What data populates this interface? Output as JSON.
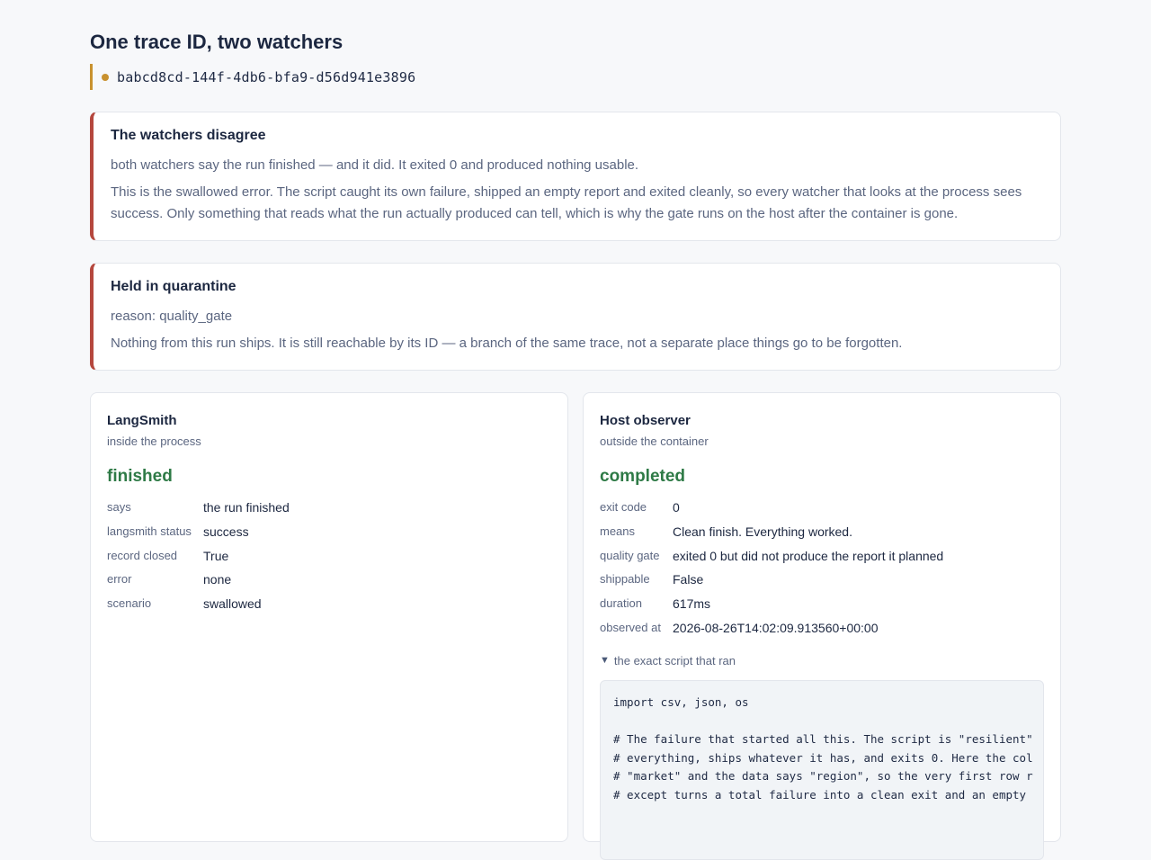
{
  "header": {
    "title": "One trace ID, two watchers",
    "trace_id": "babcd8cd-144f-4db6-bfa9-d56d941e3896"
  },
  "alerts": [
    {
      "title": "The watchers disagree",
      "lead": "both watchers say the run finished — and it did. It exited 0 and produced nothing usable.",
      "body": "This is the swallowed error. The script caught its own failure, shipped an empty report and exited cleanly, so every watcher that looks at the process sees success. Only something that reads what the run actually produced can tell, which is why the gate runs on the host after the container is gone."
    },
    {
      "title": "Held in quarantine",
      "lead": "reason: quality_gate",
      "body": "Nothing from this run ships. It is still reachable by its ID — a branch of the same trace, not a separate place things go to be forgotten."
    }
  ],
  "langsmith": {
    "title": "LangSmith",
    "subtitle": "inside the process",
    "status": "finished",
    "rows": [
      {
        "k": "says",
        "v": "the run finished"
      },
      {
        "k": "langsmith status",
        "v": "success"
      },
      {
        "k": "record closed",
        "v": "True"
      },
      {
        "k": "error",
        "v": "none"
      },
      {
        "k": "scenario",
        "v": "swallowed"
      }
    ]
  },
  "host": {
    "title": "Host observer",
    "subtitle": "outside the container",
    "status": "completed",
    "rows": [
      {
        "k": "exit code",
        "v": "0"
      },
      {
        "k": "means",
        "v": "Clean finish. Everything worked."
      },
      {
        "k": "quality gate",
        "v": "exited 0 but did not produce the report it planned"
      },
      {
        "k": "shippable",
        "v": "False"
      },
      {
        "k": "duration",
        "v": "617ms"
      },
      {
        "k": "observed at",
        "v": "2026-08-26T14:02:09.913560+00:00"
      }
    ],
    "script_toggle": "the exact script that ran",
    "script_code": "import csv, json, os\n\n# The failure that started all this. The script is \"resilient\"\n# everything, ships whatever it has, and exits 0. Here the col\n# \"market\" and the data says \"region\", so the very first row r\n# except turns a total failure into a clean exit and an empty"
  },
  "colors": {
    "accent_gold": "#c8912f",
    "alert_red": "#b5473d",
    "status_green": "#2e7a46"
  }
}
